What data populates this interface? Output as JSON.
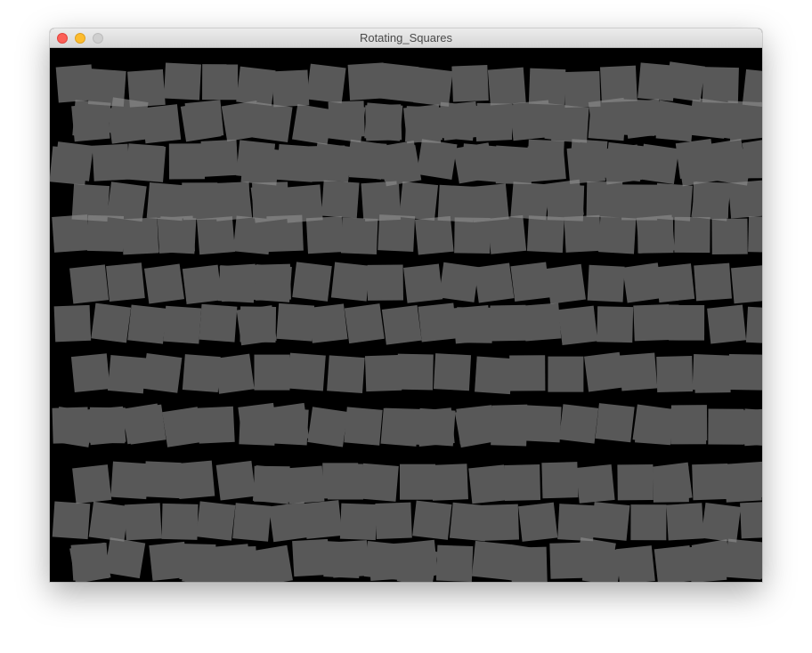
{
  "window": {
    "title": "Rotating_Squares",
    "buttons": {
      "close": {
        "icon": "close-circle-icon",
        "color": "#fc5f57"
      },
      "minimize": {
        "icon": "minimize-circle-icon",
        "color": "#fdbc2e"
      },
      "zoom": {
        "icon": "zoom-circle-icon",
        "color": "#cfcfcf"
      }
    }
  },
  "canvas": {
    "background_color": "#000000",
    "square_color": "#595959",
    "overlap_highlight_color": "#a0a0a0"
  }
}
